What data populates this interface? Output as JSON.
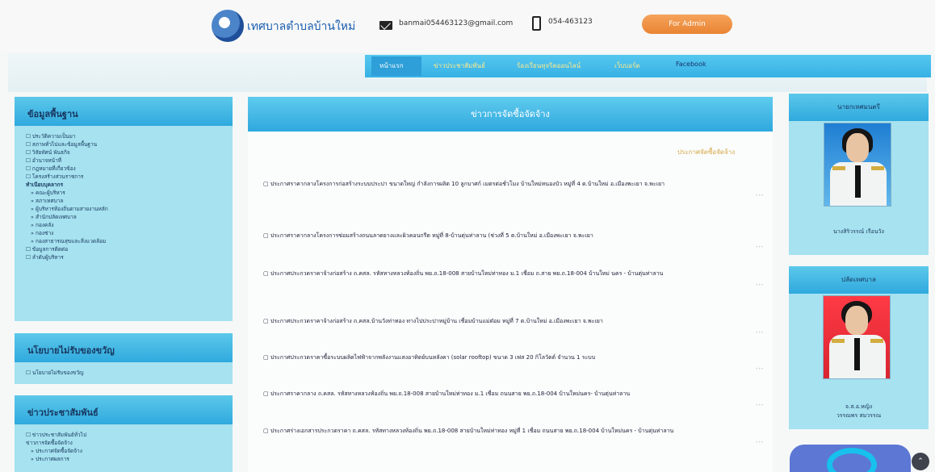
{
  "header": {
    "site_title": "เทศบาลตำบลบ้านใหม่",
    "email": "banmai054463123@gmail.com",
    "phone": "054-463123",
    "admin_button": "For Admin"
  },
  "nav": {
    "items": [
      "หน้าแรก",
      "ข่าวประชาสัมพันธ์",
      "ร้องเรียนทุจริตออนไลน์",
      "เว็บบอร์ด",
      "Facebook"
    ]
  },
  "sidebar": {
    "section1_title": "ข้อมูลพื้นฐาน",
    "section1_items": [
      "ประวัติความเป็นมา",
      "สภาพทั่วไปและข้อมูลพื้นฐาน",
      "วิสัยทัศน์ พันธกิจ",
      "อำนาจหน้าที่",
      "กฎหมายที่เกี่ยวข้อง",
      "โครงสร้างส่วนราชการ",
      "ทำเนียบบุคลากร",
      "คณะผู้บริหาร",
      "สภาเทศบาล",
      "ผู้บริหารท้องถิ่นตามสายงานหลัก",
      "สำนักปลัดเทศบาล",
      "กองคลัง",
      "กองช่าง",
      "กองสาธารณสุขและสิ่งแวดล้อม",
      "ข้อมูลการติดต่อ",
      "ลำดับผู้บริหาร"
    ],
    "section2_title": "นโยบายไม่รับของขวัญ",
    "section2_items": [
      "นโยบายไม่รับของขวัญ"
    ],
    "section3_title": "ข่าวประชาสัมพันธ์",
    "section3_items": [
      "ข่าวประชาสัมพันธ์ทั่วไป",
      "ข่าวการจัดซื้อจัดจ้าง",
      "ประกาศจัดซื้อจัดจ้าง",
      "ประกาศผลการ"
    ]
  },
  "main": {
    "title": "ข่าวการจัดซื้อจัดจ้าง",
    "more_link": "ประกาศจัดซื้อจัดจ้าง",
    "news": [
      "ประกาศราคากลางโครงการก่อสร้างระบบประปา ขนาดใหญ่ กำลังการผลิต 10 ลูกบาศก์ เมตรต่อชั่วโมง บ้านใหม่หนองบัว หมู่ที่ 4 ต.บ้านใหม่ อ.เมืองพะเยา จ.พะเยา",
      "ประกาศราคากลางโครงการซ่อมสร้างถนนลาดยางและผิวคอนกรีต หมู่ที่ 8-บ้านตุ่นท่าลาน (ช่วงที่ 5 ต.บ้านใหม่ อ.เมืองพะเยา จ.พะเยา",
      "ประกาศประกวดราคาจ้างก่อสร้าง ถ.คสล. รหัสทางหลวงท้องถิ่น พย.ถ.18-008 สายบ้านใหม่ท่าทอง ม.1 เชื่อม ถ.สาย พย.ถ.18-004 บ้านใหม่ นคร - บ้านตุ่นท่าลาน",
      "ประกาศประกวดราคาจ้างก่อสร้าง ถ.คสล.บ้านวังท่าทอง ทางไปประปาหมู่บ้าน เชื่อมบ้านแม่ต๋อม หมู่ที่ 7 ต.บ้านใหม่ อ.เมืองพะเยา จ.พะเยา",
      "ประกาศประกวดราคาซื้อระบบผลิตไฟฟ้าจากพลังงานแสงอาทิตย์บนหลังคา (solar rooftop) ขนาด 3 เฟส 20 กิโลวัตต์ จำนวน 1 ระบบ",
      "ประกาศราคากลาง ถ.คสล. รหัสทางหลวงท้องถิ่น พย.ถ.18-008 สายบ้านใหม่ท่าทอง ม.1 เชื่อม ถนนสาย พย.ถ.18-004 บ้านใหม่นคร- บ้านตุ่นท่าลาน",
      "ประกาศร่างเอกสารประกวดราคา ถ.คสล. รหัสทางหลวงท้องถิ่น พย.ถ.18-008 สายบ้านใหม่ท่าทอง หมู่ที่ 1 เชื่อม ถนนสาย พย.ถ.18-004 บ้านใหม่นคร - บ้านตุ่นท่าลาน"
    ]
  },
  "right": {
    "mayor_title": "นายกเทศมนตรี",
    "mayor_name": "นางสิริวรรณ์ เรือนวัง",
    "clerk_title": "ปลัดเทศบาล",
    "clerk_name_line1": "จ.ส.อ.หญิง",
    "clerk_name_line2": "วรรณพร สมวรรณ"
  },
  "colors": {
    "accent": "#36b1e5",
    "nav_link": "#ffe98a",
    "admin_button": "#e98433",
    "sidebar_bg": "#a6e2ef"
  }
}
